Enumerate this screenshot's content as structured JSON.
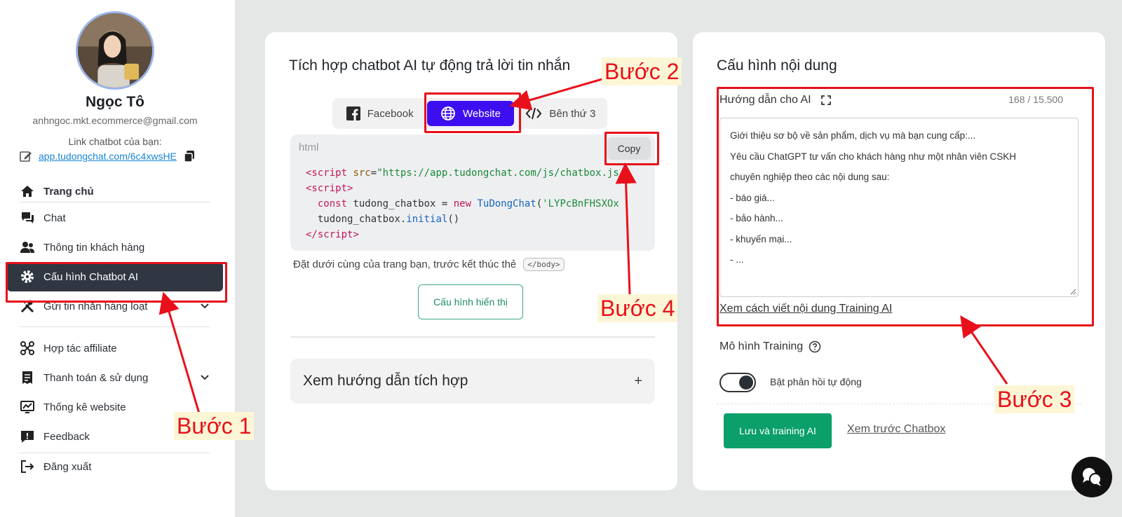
{
  "user": {
    "name": "Ngọc Tô",
    "email": "anhngoc.mkt.ecommerce@gmail.com",
    "link_label": "Link chatbot của bạn:",
    "link_url": "app.tudongchat.com/6c4xwsHE"
  },
  "nav": {
    "items": [
      {
        "label": "Trang chủ",
        "icon": "home-icon"
      },
      {
        "label": "Chat",
        "icon": "chat-bubbles-icon"
      },
      {
        "label": "Thông tin khách hàng",
        "icon": "users-icon"
      },
      {
        "label": "Cấu hình Chatbot AI",
        "icon": "gear-icon",
        "active": true
      },
      {
        "label": "Gửi tin nhắn hàng loạt",
        "icon": "tools-icon"
      },
      {
        "label": "Hợp tác affiliate",
        "icon": "network-icon"
      },
      {
        "label": "Thanh toán & sử dụng",
        "icon": "receipt-icon"
      },
      {
        "label": "Thống kê website",
        "icon": "chart-icon"
      },
      {
        "label": "Feedback",
        "icon": "feedback-icon"
      },
      {
        "label": "Đăng xuất",
        "icon": "logout-icon"
      }
    ]
  },
  "integration": {
    "title": "Tích hợp chatbot AI tự động trả lời tin nhắn",
    "tabs": [
      {
        "label": "Facebook"
      },
      {
        "label": "Website",
        "active": true
      },
      {
        "label": "Bên thứ 3"
      }
    ],
    "code_lang": "html",
    "copy_label": "Copy",
    "code": {
      "src_url": "\"https://app.tudongchat.com/js/chatbox.js",
      "id": "'LYPcBnFHSXOx"
    },
    "hint": "Đặt dưới cùng của trang bạn, trước kết thúc thẻ",
    "hint_tag": "</body>",
    "config_button": "Cấu hình hiển thị",
    "guide_accordion": "Xem hướng dẫn tích hợp",
    "accordion_toggle": "+"
  },
  "content_config": {
    "title": "Cấu hình nội dung",
    "ai_label": "Hướng dẫn cho AI",
    "char_count": "168 / 15.500",
    "prompt_lines": [
      "Giới thiệu sơ bộ về sản phẩm, dịch vụ mà bạn cung cấp:...",
      "Yêu cầu ChatGPT tư vấn cho khách hàng như một nhân viên CSKH",
      "chuyên nghiệp theo các nội dung sau:",
      "- báo giá...",
      "- bảo hành...",
      "- khuyến mại...",
      "- ..."
    ],
    "guide_link": "Xem cách viết nội dung Training AI",
    "model_label": "Mô hình Training",
    "auto_reply_label": "Bật phản hồi tự động",
    "auto_reply_on": true,
    "save_button": "Lưu và training AI",
    "preview_link": "Xem trước Chatbox"
  },
  "annotations": {
    "step1": "Bước 1",
    "step2": "Bước 2",
    "step3": "Bước 3",
    "step4": "Bước 4",
    "color": "#e8101a"
  }
}
